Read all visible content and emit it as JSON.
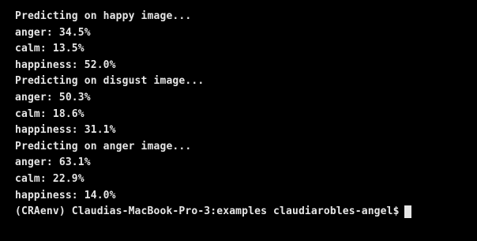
{
  "terminal": {
    "lines": [
      "Predicting on happy image...",
      "anger: 34.5%",
      "calm: 13.5%",
      "happiness: 52.0%",
      "Predicting on disgust image...",
      "anger: 50.3%",
      "calm: 18.6%",
      "happiness: 31.1%",
      "Predicting on anger image...",
      "anger: 63.1%",
      "calm: 22.9%",
      "happiness: 14.0%"
    ],
    "prompt": "(CRAenv) Claudias-MacBook-Pro-3:examples claudiarobles-angel$"
  },
  "colors": {
    "background": "#000000",
    "text": "#e6e6e6"
  }
}
